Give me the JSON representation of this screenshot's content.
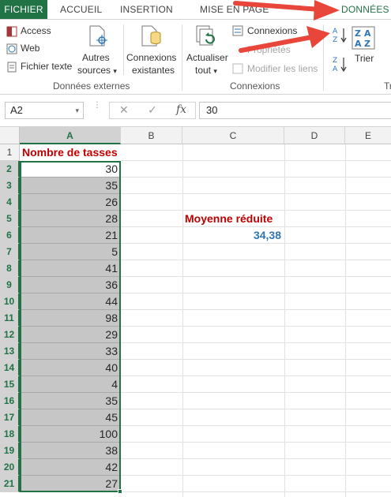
{
  "tabs": {
    "fichier": "FICHIER",
    "accueil": "ACCUEIL",
    "insertion": "INSERTION",
    "mise": "MISE EN PAGE",
    "donnees": "DONNÉES"
  },
  "ribbon": {
    "access": "Access",
    "web": "Web",
    "fichier_texte": "Fichier texte",
    "autres_line1": "Autres",
    "autres_line2": "sources",
    "connexions_ex_line1": "Connexions",
    "connexions_ex_line2": "existantes",
    "donnees_externes": "Données externes",
    "actualiser_line1": "Actualiser",
    "actualiser_line2": "tout",
    "connexions": "Connexions",
    "proprietes": "Propriétés",
    "modifier_liens": "Modifier les liens",
    "connexions_group": "Connexions",
    "trier": "Trier",
    "tr_group": "Tr",
    "dropdown_caret": "▾"
  },
  "formula_bar": {
    "name_box": "A2",
    "cancel": "✕",
    "confirm": "✓",
    "fx": "fx",
    "value": "30"
  },
  "columns": [
    "A",
    "B",
    "C",
    "D",
    "E"
  ],
  "rows": [
    "1",
    "2",
    "3",
    "4",
    "5",
    "6",
    "7",
    "8",
    "9",
    "10",
    "11",
    "12",
    "13",
    "14",
    "15",
    "16",
    "17",
    "18",
    "19",
    "20",
    "21"
  ],
  "cells": {
    "header": "Nombre de tasses",
    "values": [
      "30",
      "35",
      "26",
      "28",
      "21",
      "5",
      "41",
      "36",
      "44",
      "98",
      "29",
      "33",
      "40",
      "4",
      "35",
      "45",
      "100",
      "38",
      "42",
      "27"
    ],
    "moyenne_label": "Moyenne réduite",
    "moyenne_value": "34,38"
  },
  "colors": {
    "excel_green": "#217346",
    "arrow_red": "#e8463a",
    "header_red": "#c00000",
    "result_blue": "#2e75b6"
  }
}
